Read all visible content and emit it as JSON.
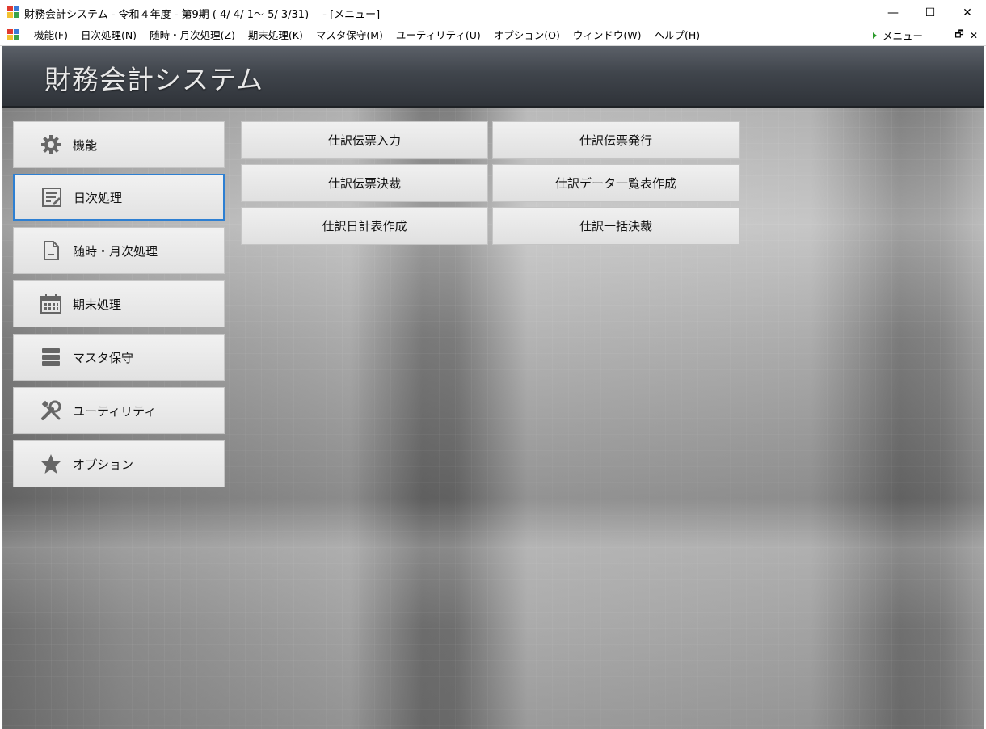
{
  "window": {
    "title": "財務会計システム - 令和４年度 - 第9期 ( 4/ 4/ 1～ 5/ 3/31)　 - [メニュー]",
    "controls": {
      "minimize": "—",
      "maximize": "☐",
      "close": "✕"
    }
  },
  "menubar": {
    "items": [
      "機能(F)",
      "日次処理(N)",
      "随時・月次処理(Z)",
      "期末処理(K)",
      "マスタ保守(M)",
      "ユーティリティ(U)",
      "オプション(O)",
      "ウィンドウ(W)",
      "ヘルプ(H)"
    ],
    "right_label": "メニュー",
    "mdi_controls": {
      "minimize": "‒",
      "restore": "🗗",
      "close": "✕"
    }
  },
  "banner": {
    "title": "財務会計システム"
  },
  "nav": {
    "items": [
      {
        "label": "機能",
        "icon": "gear-icon"
      },
      {
        "label": "日次処理",
        "icon": "edit-note-icon",
        "active": true
      },
      {
        "label": "随時・月次処理",
        "icon": "document-icon"
      },
      {
        "label": "期末処理",
        "icon": "calendar-icon"
      },
      {
        "label": "マスタ保守",
        "icon": "storage-icon"
      },
      {
        "label": "ユーティリティ",
        "icon": "tools-icon"
      },
      {
        "label": "オプション",
        "icon": "star-icon"
      }
    ]
  },
  "functions": {
    "items": [
      "仕訳伝票入力",
      "仕訳伝票発行",
      "仕訳伝票決裁",
      "仕訳データ一覧表作成",
      "仕訳日計表作成",
      "仕訳一括決裁"
    ]
  },
  "colors": {
    "active_border": "#2d7fd2",
    "banner": "#40454c"
  }
}
